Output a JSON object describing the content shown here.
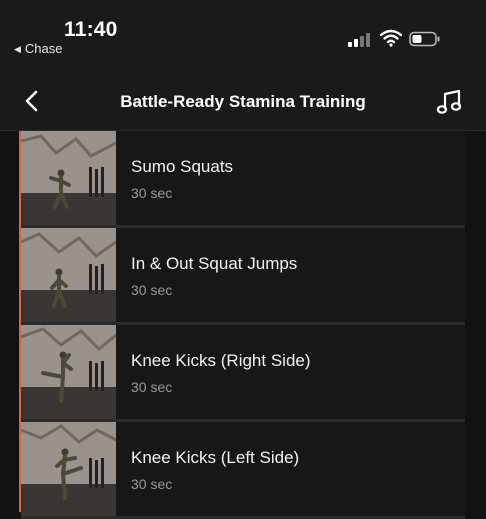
{
  "status": {
    "time": "11:40",
    "back_app": "Chase"
  },
  "header": {
    "title": "Battle-Ready Stamina Training"
  },
  "icons": {
    "back": "chevron-left-icon",
    "music": "music-note-icon"
  },
  "colors": {
    "accent": "#e06040",
    "background": "#121212",
    "row": "#171717"
  },
  "exercises": [
    {
      "name": "Sumo Squats",
      "duration": "30 sec"
    },
    {
      "name": "In & Out Squat Jumps",
      "duration": "30 sec"
    },
    {
      "name": "Knee Kicks (Right Side)",
      "duration": "30 sec"
    },
    {
      "name": "Knee Kicks (Left Side)",
      "duration": "30 sec"
    }
  ]
}
